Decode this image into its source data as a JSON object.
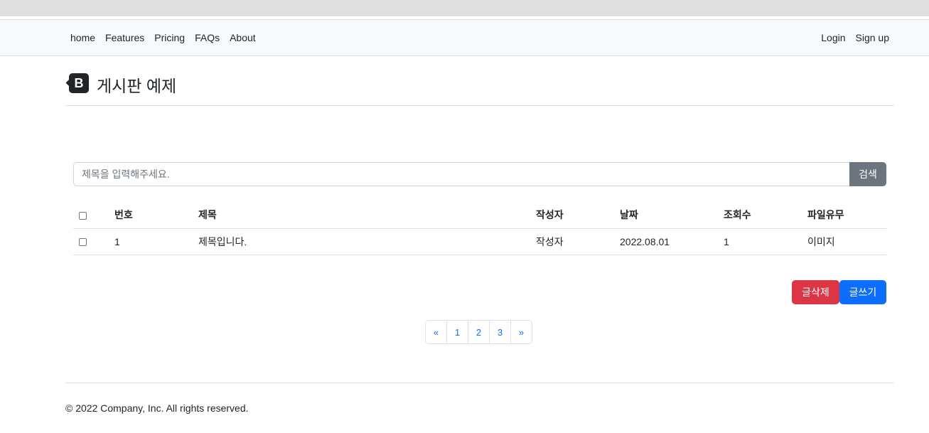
{
  "nav": {
    "left": [
      "home",
      "Features",
      "Pricing",
      "FAQs",
      "About"
    ],
    "right": [
      "Login",
      "Sign up"
    ]
  },
  "header": {
    "logo_letter": "B",
    "title": "게시판 예제"
  },
  "search": {
    "placeholder": "제목을 입력해주세요.",
    "button": "검색"
  },
  "table": {
    "columns": [
      "번호",
      "제목",
      "작성자",
      "날짜",
      "조회수",
      "파일유무"
    ],
    "rows": [
      {
        "no": "1",
        "title": "제목입니다.",
        "author": "작성자",
        "date": "2022.08.01",
        "views": "1",
        "file": "이미지"
      }
    ]
  },
  "actions": {
    "delete": "글삭제",
    "write": "글쓰기"
  },
  "pagination": [
    "«",
    "1",
    "2",
    "3",
    "»"
  ],
  "footer": {
    "copyright": "© 2022 Company, Inc. All rights reserved."
  },
  "colors": {
    "primary": "#0d6efd",
    "danger": "#dc3545",
    "secondary": "#6c757d",
    "navbar_bg": "#f8f9fa"
  }
}
